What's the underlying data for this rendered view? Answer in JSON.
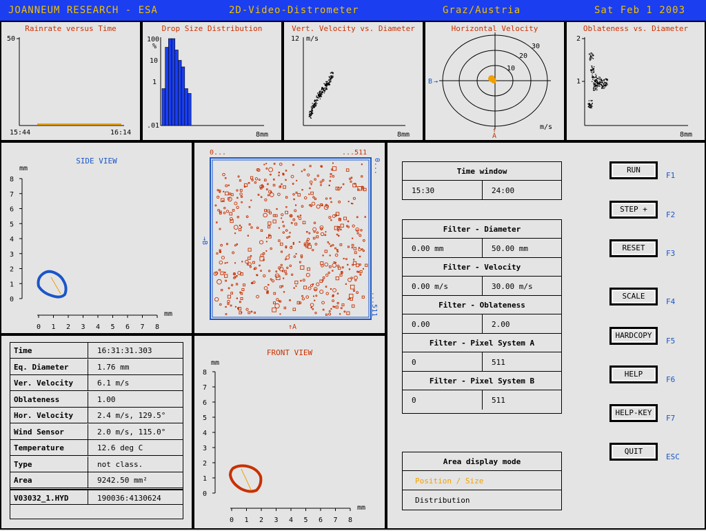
{
  "header": {
    "org": "JOANNEUM RESEARCH - ESA",
    "app": "2D-Video-Distrometer",
    "location": "Graz/Austria",
    "date": "Sat Feb  1 2003"
  },
  "colors": {
    "title_bg": "#1a3ef0",
    "title_text": "#f0c000",
    "accent_red": "#c83000",
    "accent_blue": "#1a56c8",
    "highlight_orange": "#f0a000"
  },
  "charts": {
    "rainrate": {
      "title": "Rainrate versus Time",
      "y_max_label": "50",
      "x_start": "15:44",
      "x_end": "16:14"
    },
    "dsd": {
      "title": "Drop Size Distribution",
      "unit": "%",
      "y_ticks": [
        "100",
        "10",
        "1",
        ".01"
      ],
      "x_label": "8mm"
    },
    "vert_velocity": {
      "title": "Vert. Velocity vs. Diameter",
      "y_max_label": "12",
      "y_unit": "m/s",
      "x_label": "8mm"
    },
    "horizontal": {
      "title": "Horizontal Velocity",
      "ring_labels": [
        "10",
        "20",
        "30"
      ],
      "b_label": "B",
      "a_label": "A",
      "unit": "m/s"
    },
    "oblateness": {
      "title": "Oblateness vs. Diameter",
      "y_ticks": [
        "2",
        "1"
      ],
      "x_label": "8mm"
    }
  },
  "chart_data": [
    {
      "type": "line",
      "title": "Rainrate versus Time",
      "x": [
        "15:44",
        "16:14"
      ],
      "series": [
        {
          "values": [
            0,
            0
          ]
        }
      ],
      "ylim": [
        0,
        50
      ]
    },
    {
      "type": "bar",
      "title": "Drop Size Distribution",
      "ylabel": "%",
      "yscale": "log",
      "ylim": [
        0.01,
        100
      ],
      "xlim": [
        0,
        8
      ],
      "xlabel": "8mm",
      "categories": [
        "0.25",
        "0.5",
        "0.75",
        "1.0",
        "1.25",
        "1.5",
        "1.75",
        "2.0",
        "2.25"
      ],
      "values": [
        0.5,
        40,
        100,
        100,
        30,
        10,
        5,
        0.5,
        0.3
      ]
    },
    {
      "type": "scatter",
      "title": "Vert. Velocity vs. Diameter",
      "ylabel": "m/s",
      "xlim": [
        0,
        8
      ],
      "ylim": [
        0,
        12
      ],
      "x": [
        0.5,
        0.6,
        0.7,
        0.8,
        0.9,
        1.0,
        1.1,
        1.2,
        1.3,
        1.4,
        1.5,
        1.6,
        1.7,
        1.8,
        1.9,
        2.0,
        2.1,
        2.2
      ],
      "y": [
        1.5,
        2.0,
        2.4,
        2.8,
        3.1,
        3.5,
        3.8,
        4.1,
        4.4,
        4.7,
        5.0,
        5.2,
        5.5,
        5.7,
        6.0,
        6.2,
        6.5,
        7.0
      ]
    },
    {
      "type": "scatter",
      "title": "Oblateness vs. Diameter",
      "xlim": [
        0,
        8
      ],
      "ylim": [
        0,
        2
      ],
      "x": [
        0.4,
        0.5,
        0.6,
        0.7,
        0.8,
        0.9,
        1.0,
        1.2,
        1.4,
        1.6
      ],
      "y": [
        0.5,
        1.6,
        1.3,
        1.1,
        0.9,
        1.0,
        1.05,
        1.0,
        0.95,
        1.0
      ]
    }
  ],
  "side_view": {
    "title": "SIDE VIEW",
    "y_unit": "mm",
    "x_unit": "mm",
    "ticks": [
      "0",
      "1",
      "2",
      "3",
      "4",
      "5",
      "6",
      "7",
      "8"
    ]
  },
  "front_view": {
    "title": "FRONT VIEW",
    "y_unit": "mm",
    "x_unit": "mm",
    "ticks": [
      "0",
      "1",
      "2",
      "3",
      "4",
      "5",
      "6",
      "7",
      "8"
    ]
  },
  "area_display": {
    "top_left": "0...",
    "top_right": "...511",
    "right_top": "0...",
    "right_bottom": "...511",
    "b_label": "→B",
    "a_label": "↑A"
  },
  "info": [
    {
      "key": "Time",
      "value": "16:31:31.303"
    },
    {
      "key": "Eq. Diameter",
      "value": "1.76 mm"
    },
    {
      "key": "Ver. Velocity",
      "value": "6.1 m/s"
    },
    {
      "key": "Oblateness",
      "value": "1.00"
    },
    {
      "key": "Hor. Velocity",
      "value": "2.4 m/s, 129.5°"
    },
    {
      "key": "Wind Sensor",
      "value": "2.0 m/s, 115.0°"
    },
    {
      "key": "Temperature",
      "value": "12.6 deg C"
    },
    {
      "key": "Type",
      "value": "not class."
    },
    {
      "key": "Area",
      "value": "9242.50 mm²"
    },
    {
      "key": "V03032_1.HYD",
      "value": "190036:4130624"
    }
  ],
  "time_window": {
    "title": "Time window",
    "from": "15:30",
    "to": "24:00"
  },
  "filters": [
    {
      "title": "Filter - Diameter",
      "min": "0.00 mm",
      "max": "50.00 mm"
    },
    {
      "title": "Filter - Velocity",
      "min": "0.00 m/s",
      "max": "30.00 m/s"
    },
    {
      "title": "Filter - Oblateness",
      "min": "0.00",
      "max": "2.00"
    },
    {
      "title": "Filter - Pixel System A",
      "min": "0",
      "max": "511"
    },
    {
      "title": "Filter - Pixel System B",
      "min": "0",
      "max": "511"
    }
  ],
  "area_mode": {
    "title": "Area display mode",
    "option1": "Position / Size",
    "option2": "Distribution",
    "selected": "Position / Size"
  },
  "buttons": [
    {
      "label": "RUN",
      "key": "F1"
    },
    {
      "label": "STEP +",
      "key": "F2"
    },
    {
      "label": "RESET",
      "key": "F3"
    },
    {
      "label": "SCALE",
      "key": "F4"
    },
    {
      "label": "HARDCOPY",
      "key": "F5"
    },
    {
      "label": "HELP",
      "key": "F6"
    },
    {
      "label": "HELP-KEY",
      "key": "F7"
    },
    {
      "label": "QUIT",
      "key": "ESC"
    }
  ]
}
